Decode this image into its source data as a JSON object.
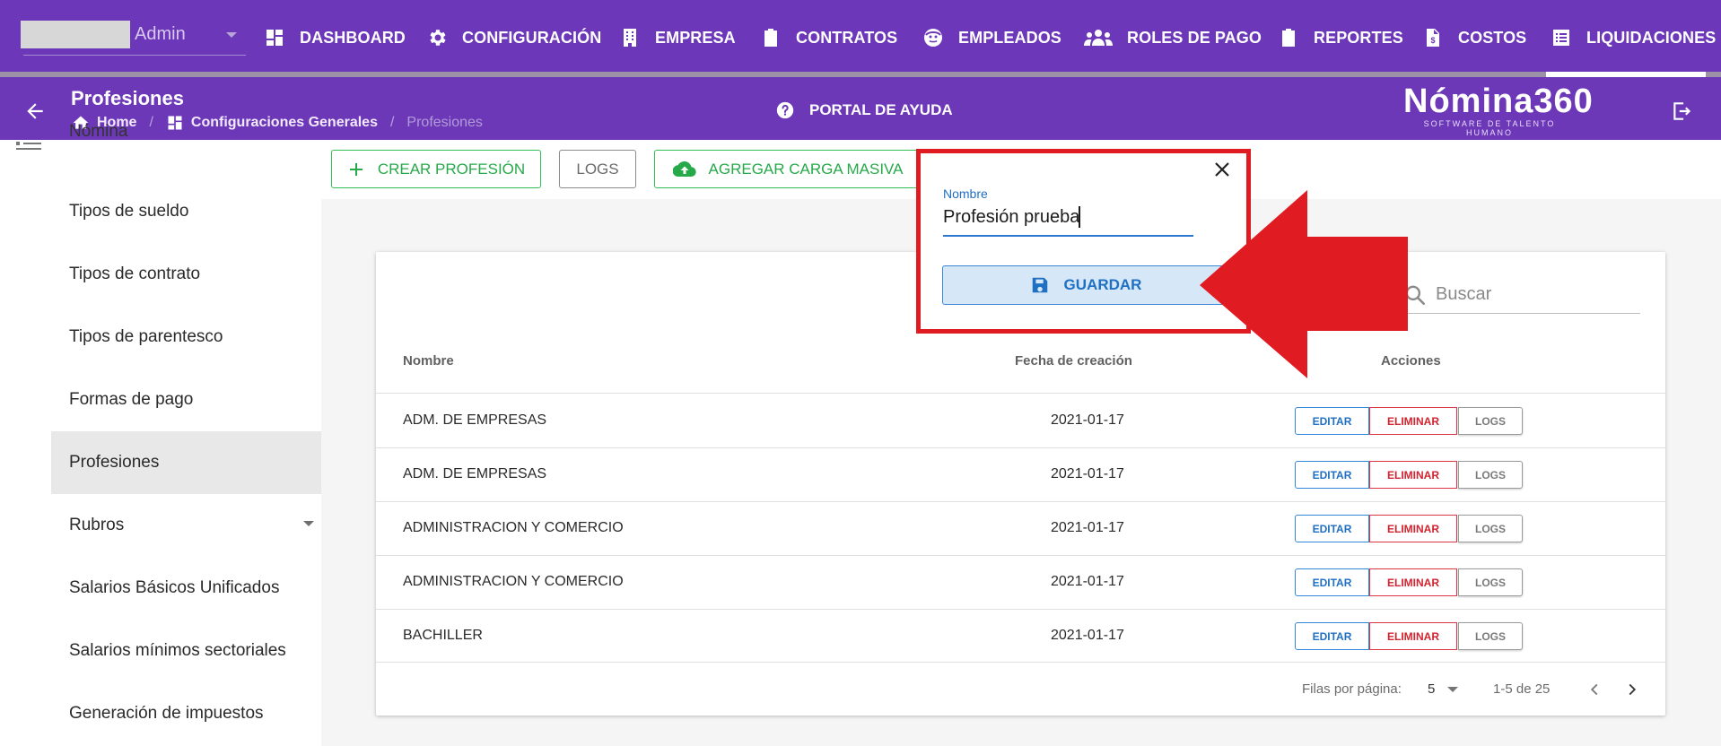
{
  "topnav": {
    "user": "Admin",
    "items": [
      {
        "label": "DASHBOARD",
        "icon": "dashboard-icon"
      },
      {
        "label": "CONFIGURACIÓN",
        "icon": "gear-icon"
      },
      {
        "label": "EMPRESA",
        "icon": "building-icon"
      },
      {
        "label": "CONTRATOS",
        "icon": "clipboard-icon"
      },
      {
        "label": "EMPLEADOS",
        "icon": "face-icon"
      },
      {
        "label": "ROLES DE PAGO",
        "icon": "people-icon"
      },
      {
        "label": "REPORTES",
        "icon": "clipboard-check-icon"
      },
      {
        "label": "COSTOS",
        "icon": "invoice-dollar-icon"
      },
      {
        "label": "LIQUIDACIONES",
        "icon": "list-icon"
      }
    ]
  },
  "subheader": {
    "title": "Profesiones",
    "breadcrumb": {
      "home": "Home",
      "section": "Configuraciones Generales",
      "current": "Profesiones",
      "separator": "/"
    },
    "help": "PORTAL DE AYUDA",
    "logo": {
      "name": "Nómina360",
      "tagline": "SOFTWARE DE TALENTO HUMANO"
    }
  },
  "sidebar": {
    "partial": "Nómina",
    "items": [
      {
        "label": "Tipos de sueldo"
      },
      {
        "label": "Tipos de contrato"
      },
      {
        "label": "Tipos de parentesco"
      },
      {
        "label": "Formas de pago"
      },
      {
        "label": "Profesiones",
        "active": true
      },
      {
        "label": "Rubros"
      },
      {
        "label": "Salarios Básicos Unificados"
      },
      {
        "label": "Salarios mínimos sectoriales"
      },
      {
        "label": "Generación de impuestos"
      }
    ]
  },
  "toolbar": {
    "create": "CREAR PROFESIÓN",
    "logs": "LOGS",
    "bulk": "AGREGAR CARGA MASIVA"
  },
  "table": {
    "search_placeholder": "Buscar",
    "headers": {
      "name": "Nombre",
      "date": "Fecha de creación",
      "actions": "Acciones"
    },
    "rows": [
      {
        "name": "ADM. DE EMPRESAS",
        "date": "2021-01-17"
      },
      {
        "name": "ADM. DE EMPRESAS",
        "date": "2021-01-17"
      },
      {
        "name": "ADMINISTRACION Y COMERCIO",
        "date": "2021-01-17"
      },
      {
        "name": "ADMINISTRACION Y COMERCIO",
        "date": "2021-01-17"
      },
      {
        "name": "BACHILLER",
        "date": "2021-01-17"
      }
    ],
    "actions": {
      "edit": "EDITAR",
      "delete": "ELIMINAR",
      "logs": "LOGS"
    },
    "pagination": {
      "rows_label": "Filas por página:",
      "rows_value": "5",
      "range": "1-5 de 25"
    }
  },
  "modal": {
    "field_label": "Nombre",
    "field_value": "Profesión prueba",
    "save": "GUARDAR"
  },
  "colors": {
    "nav": "#6c37b8",
    "annotation_red": "#e11b22",
    "primary_blue": "#1f6fc2",
    "success_green": "#27a94a",
    "danger_red": "#d3232f"
  }
}
